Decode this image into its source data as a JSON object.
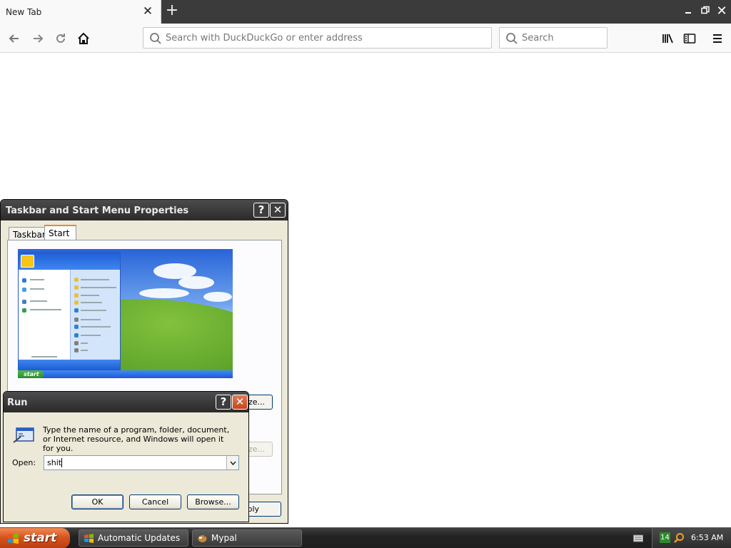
{
  "browser": {
    "tab_title": "New Tab",
    "address_placeholder": "Search with DuckDuckGo or enter address",
    "search_placeholder": "Search"
  },
  "taskbar_dialog": {
    "title": "Taskbar and Start Menu Properties",
    "tabs": [
      {
        "label": "Taskbar",
        "selected": false
      },
      {
        "label": "Start Menu",
        "selected": true
      }
    ],
    "customize_partial": "ze...",
    "customize2_partial": "ze...",
    "apply_partial": "Apply"
  },
  "run_dialog": {
    "title": "Run",
    "message": "Type the name of a program, folder, document, or Internet resource, and Windows will open it for you.",
    "open_label": "Open:",
    "open_value": "shit",
    "buttons": {
      "ok": "OK",
      "cancel": "Cancel",
      "browse": "Browse..."
    }
  },
  "taskbar": {
    "start_label": "start",
    "items": [
      {
        "label": "Automatic Updates"
      },
      {
        "label": "Mypal"
      }
    ],
    "tray_badge": "14",
    "clock": "6:53 AM"
  },
  "colors": {
    "chrome_dark": "#3b3b3b",
    "xp_face": "#ece9d8",
    "start_orange": "#d8541d",
    "tab_accent": "#e68b2c"
  }
}
